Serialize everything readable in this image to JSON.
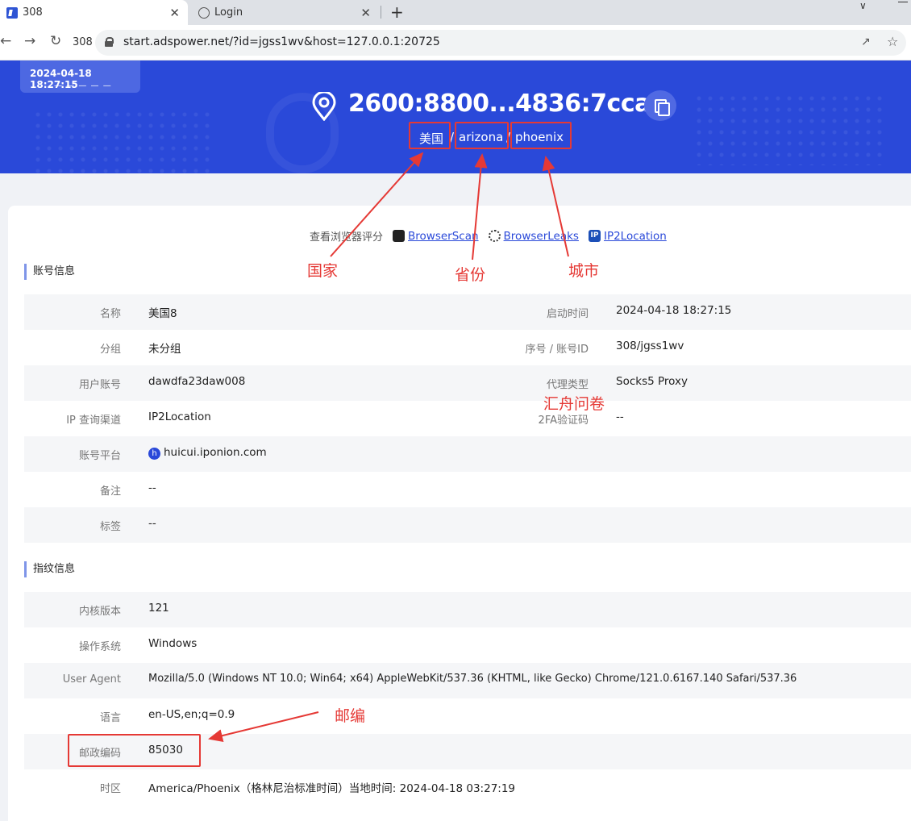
{
  "browser": {
    "tabs": [
      {
        "title": "308",
        "close": "✕"
      },
      {
        "title": "Login",
        "close": "✕"
      }
    ],
    "new_tab": "+",
    "profile_count": "308",
    "url": "start.adspower.net/?id=jgss1wv&host=127.0.0.1:20725"
  },
  "header": {
    "timestamp": "2024-04-18 18:27:15",
    "timestamp_dashes": "— — — — —",
    "ip": "2600:8800...4836:7cca",
    "country": "美国",
    "region": "arizona",
    "city": "phoenix",
    "separator": "/"
  },
  "tools": {
    "label": "查看浏览器评分",
    "browserscan": "BrowserScan",
    "browserleaks": "BrowserLeaks",
    "ip2location": "IP2Location",
    "ip2_badge": "IP",
    "bs_badge": "Scan"
  },
  "account": {
    "title": "账号信息",
    "name_label": "名称",
    "name_value": "美国8",
    "start_label": "启动时间",
    "start_value": "2024-04-18 18:27:15",
    "group_label": "分组",
    "group_value": "未分组",
    "id_label": "序号 / 账号ID",
    "id_value": "308/jgss1wv",
    "user_label": "用户账号",
    "user_value": "dawdfa23daw008",
    "proxy_label": "代理类型",
    "proxy_value": "Socks5 Proxy",
    "ipq_label": "IP 查询渠道",
    "ipq_value": "IP2Location",
    "twofa_label": "2FA验证码",
    "twofa_value": "--",
    "platform_label": "账号平台",
    "platform_value": "huicui.iponion.com",
    "platform_badge": "h",
    "note_label": "备注",
    "note_value": "--",
    "tag_label": "标签",
    "tag_value": "--"
  },
  "fingerprint": {
    "title": "指纹信息",
    "kernel_label": "内核版本",
    "kernel_value": "121",
    "os_label": "操作系统",
    "os_value": "Windows",
    "ua_label": "User Agent",
    "ua_value": "Mozilla/5.0 (Windows NT 10.0; Win64; x64) AppleWebKit/537.36 (KHTML, like Gecko) Chrome/121.0.6167.140 Safari/537.36",
    "lang_label": "语言",
    "lang_value": "en-US,en;q=0.9",
    "zip_label": "邮政编码",
    "zip_value": "85030",
    "tz_label": "时区",
    "tz_value": "America/Phoenix（格林尼治标准时间）当地时间: 2024-04-18 03:27:19"
  },
  "annotations": {
    "country": "国家",
    "province": "省份",
    "city": "城市",
    "watermark": "汇舟问卷",
    "zip": "邮编"
  },
  "colors": {
    "header_blue": "#2a49d9",
    "annotation_red": "#e53935"
  }
}
